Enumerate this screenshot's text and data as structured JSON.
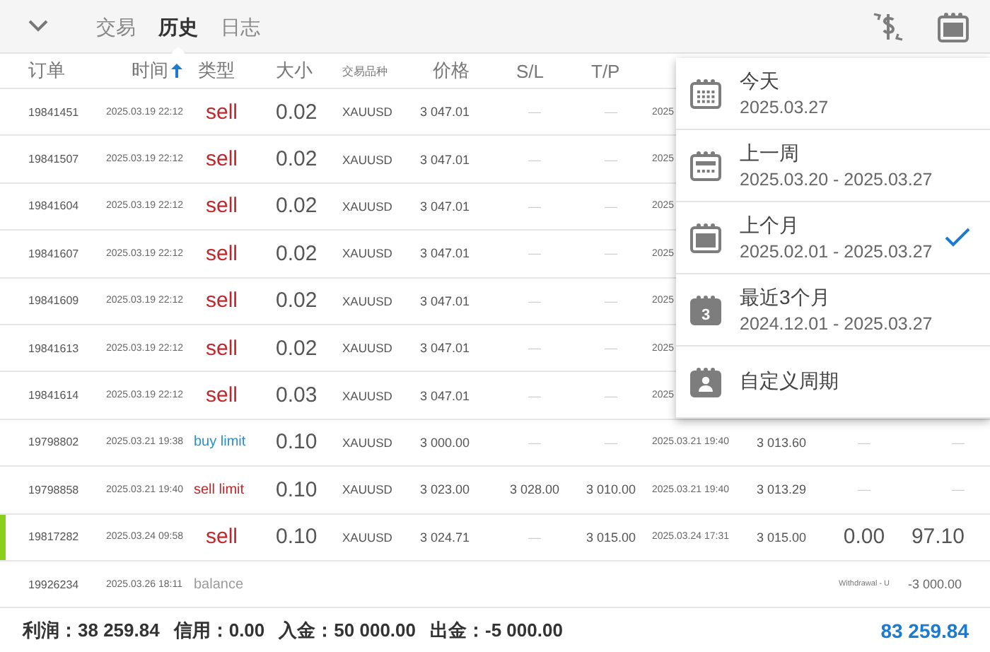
{
  "tabs": [
    {
      "label": "交易",
      "selected": false
    },
    {
      "label": "历史",
      "selected": true
    },
    {
      "label": "日志",
      "selected": false
    }
  ],
  "columns": [
    "订单",
    "时间",
    "类型",
    "大小",
    "交易品种",
    "价格",
    "S/L",
    "T/P"
  ],
  "rows": [
    {
      "kind": "trade",
      "color": "#c0282d",
      "highlighted": false,
      "cells": [
        "19841451",
        "2025.03.19 22:12",
        "sell",
        "0.02",
        "XAUUSD",
        "3 047.01",
        "—",
        "—",
        "2025"
      ]
    },
    {
      "kind": "trade",
      "color": "#c0282d",
      "highlighted": false,
      "cells": [
        "19841507",
        "2025.03.19 22:12",
        "sell",
        "0.02",
        "XAUUSD",
        "3 047.01",
        "—",
        "—",
        "2025"
      ]
    },
    {
      "kind": "trade",
      "color": "#c0282d",
      "highlighted": false,
      "cells": [
        "19841604",
        "2025.03.19 22:12",
        "sell",
        "0.02",
        "XAUUSD",
        "3 047.01",
        "—",
        "—",
        "2025"
      ]
    },
    {
      "kind": "trade",
      "color": "#c0282d",
      "highlighted": false,
      "cells": [
        "19841607",
        "2025.03.19 22:12",
        "sell",
        "0.02",
        "XAUUSD",
        "3 047.01",
        "—",
        "—",
        "2025"
      ]
    },
    {
      "kind": "trade",
      "color": "#c0282d",
      "highlighted": false,
      "cells": [
        "19841609",
        "2025.03.19 22:12",
        "sell",
        "0.02",
        "XAUUSD",
        "3 047.01",
        "—",
        "—",
        "2025"
      ]
    },
    {
      "kind": "trade",
      "color": "#c0282d",
      "highlighted": false,
      "cells": [
        "19841613",
        "2025.03.19 22:12",
        "sell",
        "0.02",
        "XAUUSD",
        "3 047.01",
        "—",
        "—",
        "2025"
      ]
    },
    {
      "kind": "trade",
      "color": "#c0282d",
      "highlighted": false,
      "cells": [
        "19841614",
        "2025.03.19 22:12",
        "sell",
        "0.03",
        "XAUUSD",
        "3 047.01",
        "—",
        "—",
        "2025"
      ]
    },
    {
      "kind": "order",
      "color": "#2a8fc8",
      "highlighted": false,
      "cells": [
        "19798802",
        "2025.03.21 19:38",
        "buy limit",
        "0.10",
        "XAUUSD",
        "3 000.00",
        "—",
        "—",
        "2025.03.21 19:40",
        "3 013.60",
        "—",
        "—"
      ]
    },
    {
      "kind": "order",
      "color": "#c0282d",
      "highlighted": false,
      "cells": [
        "19798858",
        "2025.03.21 19:40",
        "sell limit",
        "0.10",
        "XAUUSD",
        "3 023.00",
        "3 028.00",
        "3 010.00",
        "2025.03.21 19:40",
        "3 013.29",
        "—",
        "—"
      ]
    },
    {
      "kind": "trade",
      "color": "#c0282d",
      "highlighted": true,
      "cells": [
        "19817282",
        "2025.03.24 09:58",
        "sell",
        "0.10",
        "XAUUSD",
        "3 024.71",
        "—",
        "3 015.00",
        "2025.03.24 17:31",
        "3 015.00",
        "0.00",
        "97.10"
      ]
    },
    {
      "kind": "balance",
      "color": "#9a9a9a",
      "highlighted": false,
      "cells": [
        "19926234",
        "2025.03.26 18:11",
        "balance",
        "",
        "",
        "",
        "",
        "",
        "",
        "",
        "Withdrawal - U",
        "-3 000.00"
      ]
    }
  ],
  "summary": [
    {
      "label": "利润：",
      "value": "38 259.84"
    },
    {
      "label": "信用：",
      "value": "0.00"
    },
    {
      "label": "入金：",
      "value": "50 000.00"
    },
    {
      "label": "出金：",
      "value": "-5 000.00"
    }
  ],
  "balance": "83 259.84",
  "period_menu": [
    {
      "kind": "day",
      "title": "今天",
      "dates": "2025.03.27",
      "selected": false
    },
    {
      "kind": "week",
      "title": "上一周",
      "dates": "2025.03.20 - 2025.03.27",
      "selected": false
    },
    {
      "kind": "month",
      "title": "上个月",
      "dates": "2025.02.01 - 2025.03.27",
      "selected": true
    },
    {
      "kind": "number",
      "badge": "3",
      "title": "最近3个月",
      "dates": "2024.12.01 - 2025.03.27",
      "selected": false
    },
    {
      "kind": "custom",
      "title": "自定义周期",
      "selected": false
    }
  ]
}
